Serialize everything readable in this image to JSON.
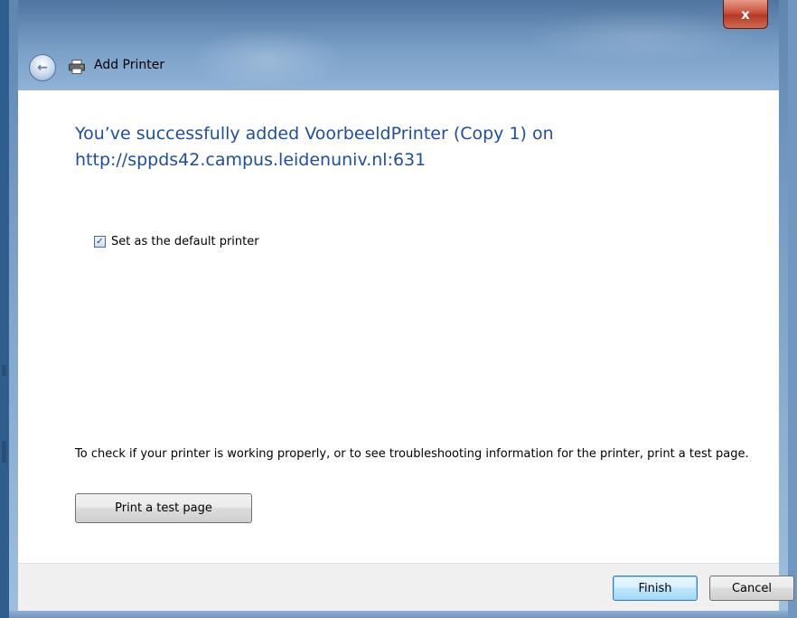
{
  "window": {
    "title": "Add Printer",
    "close_glyph": "x"
  },
  "icons": {
    "back": "back-arrow-icon",
    "printer": "printer-icon",
    "close": "close-icon",
    "check": "checkmark-icon"
  },
  "content": {
    "headline_line1": "You’ve successfully added VoorbeeldPrinter (Copy 1) on",
    "headline_line2": "http://sppds42.campus.leidenuniv.nl:631",
    "default_checkbox_label": "Set as the default printer",
    "default_checkbox_checked": true,
    "info_text": "To check if your printer is working properly, or to see troubleshooting information for the printer, print a test page.",
    "test_page_button": "Print a test page"
  },
  "footer": {
    "finish_button": "Finish",
    "cancel_button": "Cancel"
  },
  "colors": {
    "headline": "#1f4e9c",
    "frame": "#5f86b0",
    "close_button": "#c9523b"
  }
}
